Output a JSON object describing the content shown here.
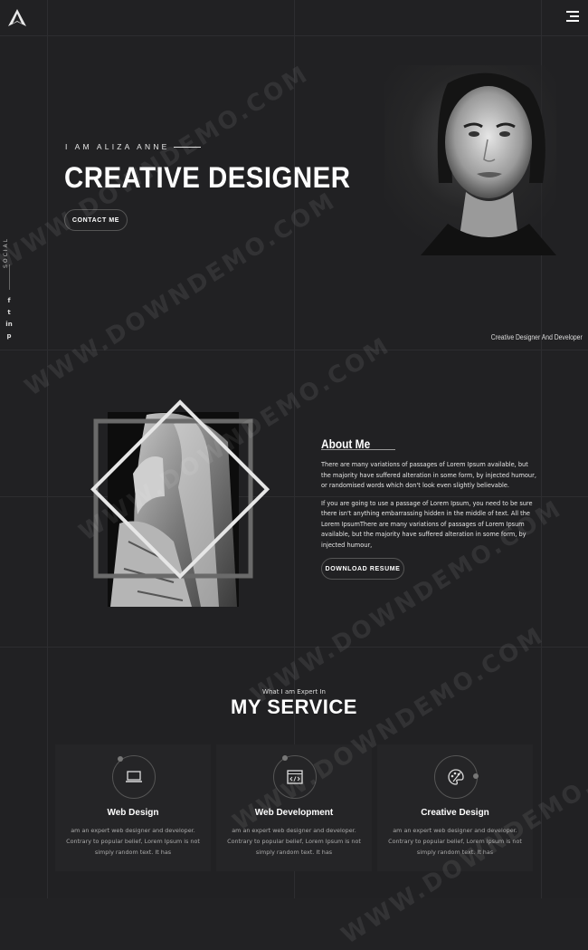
{
  "hero": {
    "eyebrow": "I AM ALIZA ANNE",
    "title": "CREATIVE DESIGNER",
    "contact_label": "CONTACT ME",
    "caption": "Creative Designer And Developer"
  },
  "social": {
    "label": "SOCIAL",
    "icons": [
      {
        "name": "facebook-icon",
        "glyph": "f"
      },
      {
        "name": "twitter-icon",
        "glyph": "t"
      },
      {
        "name": "linkedin-icon",
        "glyph": "in"
      },
      {
        "name": "pinterest-icon",
        "glyph": "p"
      }
    ]
  },
  "about": {
    "title": "About Me",
    "paragraph1": "There are many variations of passages of Lorem Ipsum available, but the majority have suffered alteration in some form, by injected humour, or randomised words which don't look even slightly believable.",
    "paragraph2": "If you are going to use a passage of Lorem Ipsum, you need to be sure there isn't anything embarrassing hidden in the middle of text. All the Lorem IpsumThere are many variations of passages of Lorem Ipsum available, but the majority have suffered alteration in some form, by injected humour,",
    "resume_label": "DOWNLOAD RESUME"
  },
  "services": {
    "subtitle": "What I am Expert In",
    "title": "MY SERVICE",
    "items": [
      {
        "name": "Web Design",
        "icon": "monitor-icon",
        "desc": "am an expert web designer and developer. Contrary to popular belief, Lorem Ipsum is not simply random text. It has"
      },
      {
        "name": "Web Development",
        "icon": "code-window-icon",
        "desc": "am an expert web designer and developer. Contrary to popular belief, Lorem Ipsum is not simply random text. It has"
      },
      {
        "name": "Creative Design",
        "icon": "palette-icon",
        "desc": "am an expert web designer and developer. Contrary to popular belief, Lorem Ipsum is not simply random text. It has"
      }
    ]
  },
  "watermark": "WWW.DOWNDEMO.COM",
  "colors": {
    "background": "#212123",
    "card": "#252527",
    "accent": "#ffffff"
  }
}
